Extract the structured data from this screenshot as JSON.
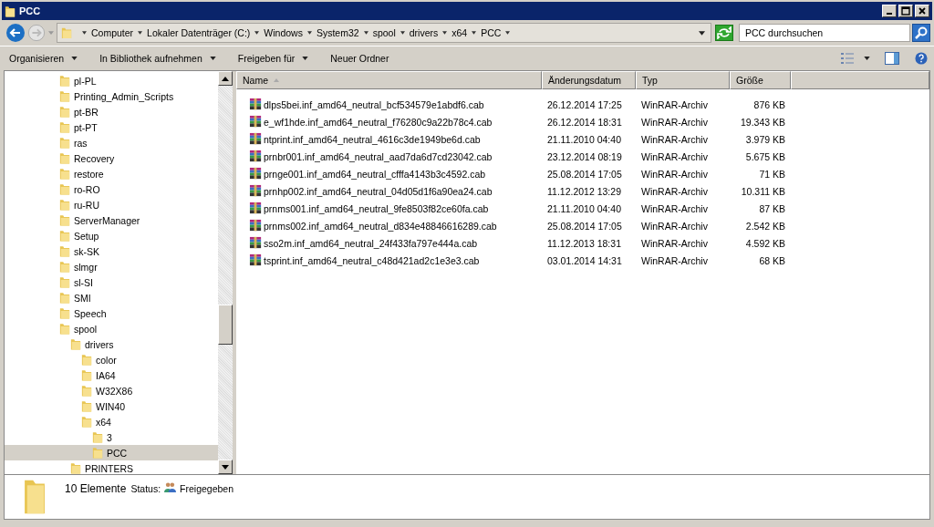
{
  "window": {
    "title": "PCC"
  },
  "breadcrumb": [
    "Computer",
    "Lokaler Datenträger (C:)",
    "Windows",
    "System32",
    "spool",
    "drivers",
    "x64",
    "PCC"
  ],
  "search": {
    "placeholder": "PCC durchsuchen"
  },
  "toolbar": [
    {
      "label": "Organisieren",
      "dropdown": true
    },
    {
      "label": "In Bibliothek aufnehmen",
      "dropdown": true
    },
    {
      "label": "Freigeben für",
      "dropdown": true
    },
    {
      "label": "Neuer Ordner",
      "dropdown": false
    }
  ],
  "tree": [
    {
      "label": "pl-PL",
      "selected": false
    },
    {
      "label": "Printing_Admin_Scripts",
      "selected": false
    },
    {
      "label": "pt-BR",
      "selected": false
    },
    {
      "label": "pt-PT",
      "selected": false
    },
    {
      "label": "ras",
      "selected": false
    },
    {
      "label": "Recovery",
      "selected": false
    },
    {
      "label": "restore",
      "selected": false
    },
    {
      "label": "ro-RO",
      "selected": false
    },
    {
      "label": "ru-RU",
      "selected": false
    },
    {
      "label": "ServerManager",
      "selected": false
    },
    {
      "label": "Setup",
      "selected": false
    },
    {
      "label": "sk-SK",
      "selected": false
    },
    {
      "label": "slmgr",
      "selected": false
    },
    {
      "label": "sl-SI",
      "selected": false
    },
    {
      "label": "SMI",
      "selected": false
    },
    {
      "label": "Speech",
      "selected": false
    },
    {
      "label": "spool",
      "selected": false,
      "children": [
        {
          "label": "drivers",
          "selected": false,
          "children": [
            {
              "label": "color",
              "selected": false
            },
            {
              "label": "IA64",
              "selected": false
            },
            {
              "label": "W32X86",
              "selected": false
            },
            {
              "label": "WIN40",
              "selected": false
            },
            {
              "label": "x64",
              "selected": false,
              "children": [
                {
                  "label": "3",
                  "selected": false
                },
                {
                  "label": "PCC",
                  "selected": true
                }
              ]
            }
          ]
        },
        {
          "label": "PRINTERS",
          "selected": false
        }
      ]
    }
  ],
  "table": {
    "columns": [
      {
        "label": "Name",
        "sorted": true
      },
      {
        "label": "Änderungsdatum",
        "sorted": false
      },
      {
        "label": "Typ",
        "sorted": false
      },
      {
        "label": "Größe",
        "sorted": false
      }
    ],
    "rows": [
      [
        "dlps5bei.inf_amd64_neutral_bcf534579e1abdf6.cab",
        "26.12.2014 17:25",
        "WinRAR-Archiv",
        "876 KB"
      ],
      [
        "e_wf1hde.inf_amd64_neutral_f76280c9a22b78c4.cab",
        "26.12.2014 18:31",
        "WinRAR-Archiv",
        "19.343 KB"
      ],
      [
        "ntprint.inf_amd64_neutral_4616c3de1949be6d.cab",
        "21.11.2010 04:40",
        "WinRAR-Archiv",
        "3.979 KB"
      ],
      [
        "prnbr001.inf_amd64_neutral_aad7da6d7cd23042.cab",
        "23.12.2014 08:19",
        "WinRAR-Archiv",
        "5.675 KB"
      ],
      [
        "prnge001.inf_amd64_neutral_cfffa4143b3c4592.cab",
        "25.08.2014 17:05",
        "WinRAR-Archiv",
        "71 KB"
      ],
      [
        "prnhp002.inf_amd64_neutral_04d05d1f6a90ea24.cab",
        "11.12.2012 13:29",
        "WinRAR-Archiv",
        "10.311 KB"
      ],
      [
        "prnms001.inf_amd64_neutral_9fe8503f82ce60fa.cab",
        "21.11.2010 04:40",
        "WinRAR-Archiv",
        "87 KB"
      ],
      [
        "prnms002.inf_amd64_neutral_d834e48846616289.cab",
        "25.08.2014 17:05",
        "WinRAR-Archiv",
        "2.542 KB"
      ],
      [
        "sso2m.inf_amd64_neutral_24f433fa797e444a.cab",
        "11.12.2013 18:31",
        "WinRAR-Archiv",
        "4.592 KB"
      ],
      [
        "tsprint.inf_amd64_neutral_c48d421ad2c1e3e3.cab",
        "03.01.2014 14:31",
        "WinRAR-Archiv",
        "68 KB"
      ]
    ]
  },
  "status_bar": {
    "count": "10 Elemente",
    "status_label": "Status:",
    "status_value": "Freigegeben"
  }
}
